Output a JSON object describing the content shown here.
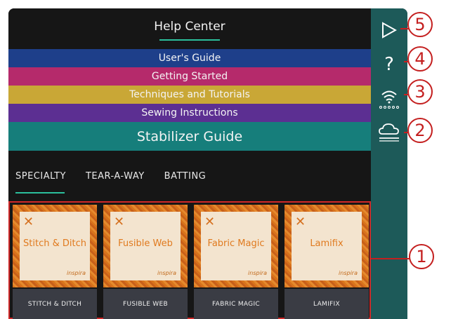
{
  "header": {
    "title": "Help Center"
  },
  "categories": [
    {
      "label": "User's Guide"
    },
    {
      "label": "Getting Started"
    },
    {
      "label": "Techniques and Tutorials"
    },
    {
      "label": "Sewing Instructions"
    },
    {
      "label": "Stabilizer Guide"
    }
  ],
  "tabs": [
    {
      "label": "SPECIALTY",
      "active": true
    },
    {
      "label": "TEAR-A-WAY",
      "active": false
    },
    {
      "label": "BATTING",
      "active": false
    }
  ],
  "cards": [
    {
      "art_name": "Stitch & Ditch",
      "label": "STITCH & DITCH",
      "brand": "inspira"
    },
    {
      "art_name": "Fusible Web",
      "label": "FUSIBLE WEB",
      "brand": "inspira"
    },
    {
      "art_name": "Fabric Magic",
      "label": "FABRIC MAGIC",
      "brand": "inspira"
    },
    {
      "art_name": "Lamifix",
      "label": "LAMIFIX",
      "brand": "inspira"
    }
  ],
  "sidebar": {
    "icons": [
      "play-icon",
      "help-icon",
      "wifi-icon",
      "cloud-icon"
    ],
    "help_glyph": "?"
  },
  "callouts": [
    "5",
    "4",
    "3",
    "2",
    "1"
  ],
  "colors": {
    "users_guide": "#1e3f8a",
    "getting_started": "#b52a6b",
    "techniques": "#c9a736",
    "sewing_instructions": "#5c2f92",
    "stabilizer_guide": "#167e7b",
    "accent": "#2bbf9c",
    "callout_red": "#c41f1f"
  }
}
